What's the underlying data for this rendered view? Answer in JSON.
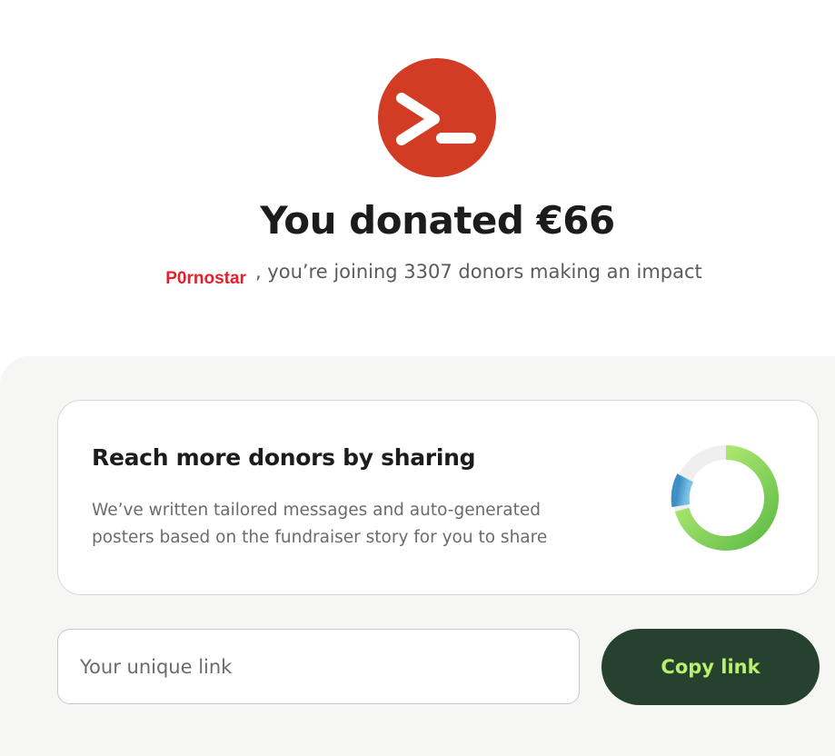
{
  "avatar": {
    "icon": "terminal-prompt-icon",
    "color": "#d23b24"
  },
  "headline": "You donated €66",
  "donor": {
    "name": "P0rnostar",
    "joining_text": ", you’re joining 3307 donors making an impact"
  },
  "share": {
    "title": "Reach more donors by sharing",
    "description": "We’ve written tailored messages and auto-generated posters based on the fundraiser story for you to share",
    "ring_icon": "share-progress-ring-icon"
  },
  "link": {
    "placeholder": "Your unique link",
    "value": ""
  },
  "copy_button": {
    "label": "Copy link",
    "bg": "#27412f",
    "color": "#b8f06f"
  }
}
